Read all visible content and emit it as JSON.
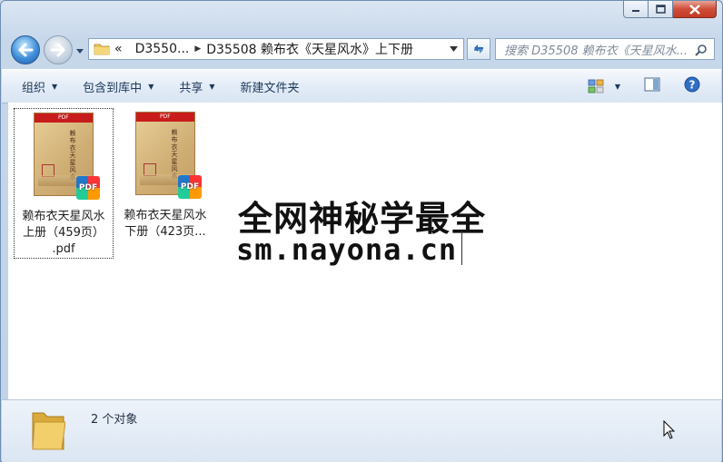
{
  "window": {
    "caption_buttons": [
      "minimize",
      "maximize",
      "close"
    ]
  },
  "address_bar": {
    "overflow": "«",
    "crumbs": [
      "D3550...",
      "D35508 赖布衣《天星风水》上下册"
    ]
  },
  "search": {
    "placeholder": "搜索 D35508 赖布衣《天星风水..."
  },
  "toolbar": {
    "organize": "组织",
    "include_library": "包含到库中",
    "share": "共享",
    "new_folder": "新建文件夹"
  },
  "files": [
    {
      "name": "赖布衣天星风水上册（459页）.pdf",
      "line1": "赖布衣天星风水",
      "line2": "上册（459页）",
      "line3": ".pdf",
      "badge": "PDF",
      "cover_band": "PDF",
      "cover_title": "赖布衣天星风水",
      "selected": true
    },
    {
      "name": "赖布衣天星风水下册（423页...",
      "line1": "赖布衣天星风水",
      "line2": "下册（423页...",
      "line3": "",
      "badge": "PDF",
      "cover_band": "PDF",
      "cover_title": "赖布衣天星风水",
      "selected": false
    }
  ],
  "watermark": {
    "line1": "全网神秘学最全",
    "line2": "sm.nayona.cn"
  },
  "status": {
    "count_text": "2 个对象"
  },
  "colors": {
    "toolbar_text": "#1e395b",
    "cover_band": "#c81c1c",
    "close_button": "#c23a24"
  }
}
